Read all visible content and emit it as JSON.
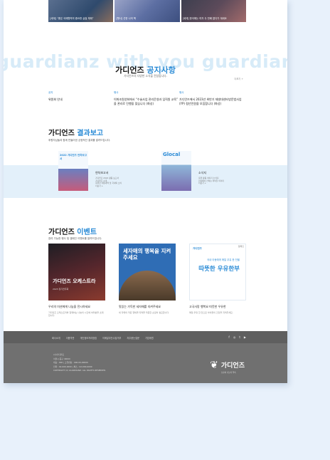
{
  "news": [
    {
      "caption": "[세계] “좋은 국제협력의 중요한 실질 체제”"
    },
    {
      "caption": "[행사] 선한 나의 책"
    },
    {
      "caption": "[세계] 한국에는 여자 두 번째 없다가 계세요"
    }
  ],
  "notice": {
    "watermark": "guardianz with you guardianz with you",
    "title_prefix": "가디언즈 ",
    "title_accent": "공지사항",
    "subtitle": "가디언즈의 다양한 소식을 전달합니다.",
    "more": "더보기 +",
    "items": [
      {
        "category": "공지",
        "text": "위원회 안내"
      },
      {
        "category": "행사",
        "text": "이화조원양회에서 “수술사업 관리운영과 임직원 교육” 을 관리로 진행을 맞습니다 (화성)"
      },
      {
        "category": "행사",
        "text": "가디언즈에서 2023년 위반기 재발대센터방문법사업(YP) 청년민원을 모집합니다 (화성)"
      }
    ]
  },
  "report": {
    "title_prefix": "가디언즈 ",
    "title_accent": "결과보고",
    "desc": "후원자님들과 함께 만들어낸 긍정적인 결과를 알려드립니다.",
    "items": [
      {
        "cover_label": "2022 가디언즈 연차보고서",
        "title": "연차보고서",
        "lines": [
          "가디언즈 2022 활동 보고서",
          "가디언즈 소개",
          "후원금 사용내역 및 국내외 소식",
          "더보기 +"
        ]
      },
      {
        "cover_label": "Glocal",
        "title": "소식지",
        "lines": [
          "후원 활동 이야기 소식지",
          "현장에서 전하는 아이들 이야기",
          "더보기 +"
        ]
      }
    ]
  },
  "events": {
    "title_prefix": "가디언즈 ",
    "title_accent": "이벤트",
    "desc": "참여 가능한 행사 및 캠페인 이벤트를 알려드립니다.",
    "items": [
      {
        "img_big": "가디언즈 오케스트라",
        "img_small": "2023 정기연주회",
        "title": "우리의 미션에게 나눔을 전시하세요",
        "desc": "가디언즈 오케스트라와 함께하는 나눔의 시간에 여러분을 초대합니다."
      },
      {
        "img_big": "세자매의 행복을 지켜주세요",
        "img_small": "",
        "title": "맛있는 가득한 세자매를 지켜주세요",
        "desc": "세 자매의 작은 행복을 지켜줄 따뜻한 손길이 필요합니다."
      },
      {
        "img_big": "따뜻한 우유한부",
        "img_small": "",
        "title": "고국사랑 행복요 따뜻한 우유한",
        "desc": "매일 우유 한 잔으로 아이들의 건강을 지켜주세요."
      }
    ],
    "ev3_brand": "가디언즈",
    "ev3_tag": "캠페인",
    "ev3_sub": "국내 아동에게 매일 우유 한 잔을"
  },
  "footer": {
    "links": [
      "회사소개",
      "이용약관",
      "개인정보처리방침",
      "이메일무단수집거부",
      "자주묻는질문",
      "기업후원"
    ],
    "social": [
      "f",
      "◎",
      "t",
      "▶"
    ],
    "info": [
      "(사)가디언즈",
      "서울시 중구 (0000)",
      "대표 : 000 | 고유번호 : 000-00-00000",
      "전화 : 02-000-0000 | 팩스 : 02-000-0000",
      "COPYRIGHT (C) GUARDIANZ. ALL RIGHTS RESERVED."
    ],
    "logo_name": "가디언즈",
    "logo_tag": "보호와 나눔의 약속"
  }
}
